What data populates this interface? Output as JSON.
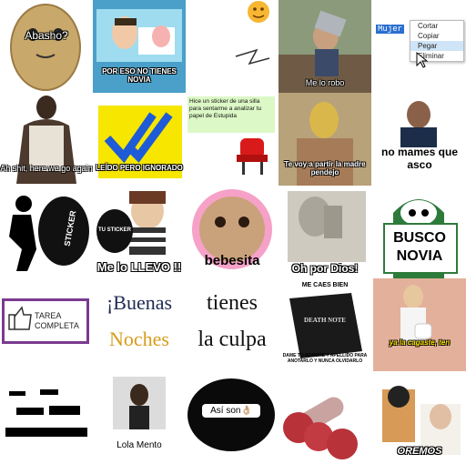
{
  "row1": {
    "potato": "Abasho?",
    "tv_caption": "POR ESO NO TIENES NOVIA",
    "boy_caption": "Me lo robo",
    "selected_word": "Mujer",
    "menu": [
      "Cortar",
      "Copiar",
      "Pegar",
      "Eliminar"
    ],
    "menu_highlight_index": 2
  },
  "row2": {
    "cj_caption": "Ah shit, here we go again",
    "ticks_caption": "LEÍDO PERO IGNORADO",
    "chair_text": "Hice un sticker de una silla para sentarme a analizar tu papel de Estupida",
    "wrestler_caption": "Te voy a partir la madre pendejo",
    "man_caption": "no mames que asco"
  },
  "row3": {
    "bag_text": "STICKER",
    "thief_sign": "TU STICKER",
    "thief_caption": "Me lo LLEVO !!",
    "frog_caption": "bebesita",
    "statue_caption": "Oh por Dios!",
    "ghost_caption": "BUSCO NOVIA"
  },
  "row4": {
    "tarea": "TAREA COMPLETA",
    "buenas_1": "¡Buenas",
    "buenas_2": "Noches",
    "tienes_1": "tienes",
    "tienes_2": "la culpa",
    "death_top": "ME CAES BIEN",
    "death_cover": "DEATH NOTE",
    "death_bottom": "DAME TU NOMBRE Y APELLIDO PARA ANOTARLO Y NUNCA OLVIDARLO",
    "tp_caption": "ya la cagaste, ten"
  },
  "row5": {
    "profile_name": "Lola Mento",
    "asi_son": "Así son👌🏼",
    "oremos": "OREMOS"
  },
  "colors": {
    "blue_check": "#1e5bd6",
    "yellow_bg": "#f6e600",
    "menu_highlight": "#cfe4f7",
    "purple_border": "#7a3b8f",
    "ghost_green": "#2d7b3b"
  }
}
